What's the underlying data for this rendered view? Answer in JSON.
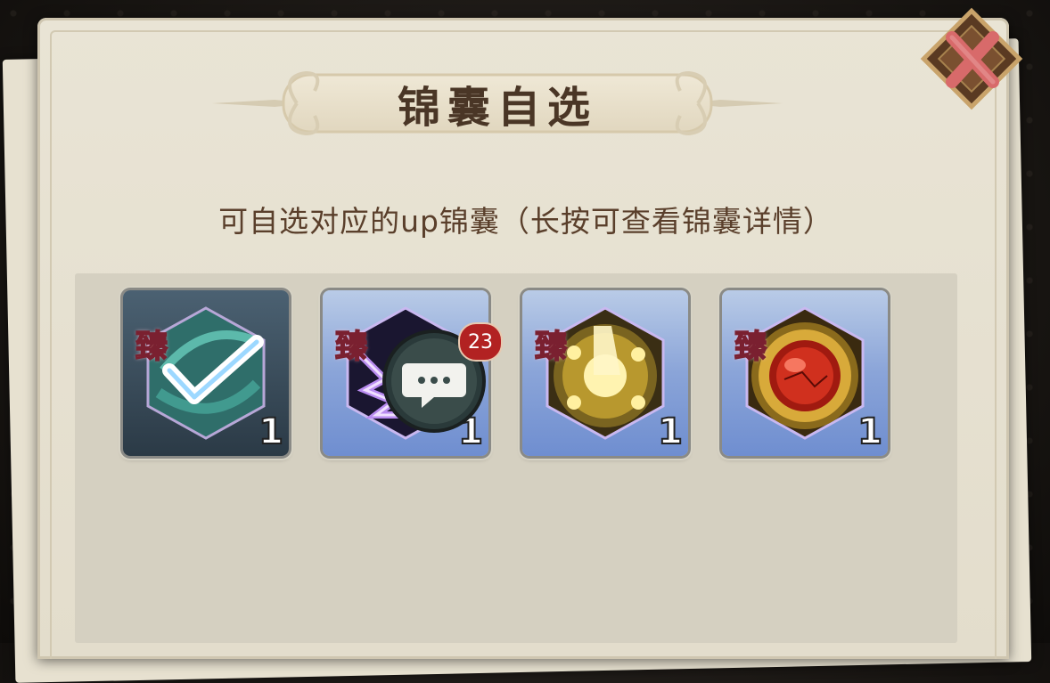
{
  "dialog": {
    "title": "锦囊自选",
    "subtitle": "可自选对应的up锦囊（长按可查看锦囊详情）"
  },
  "items": [
    {
      "tag": "臻",
      "count": "1",
      "icon": "check-swirl-icon",
      "selected": true
    },
    {
      "tag": "臻",
      "count": "1",
      "icon": "purple-claw-icon",
      "selected": false
    },
    {
      "tag": "臻",
      "count": "1",
      "icon": "golden-taiji-icon",
      "selected": false
    },
    {
      "tag": "臻",
      "count": "1",
      "icon": "red-orb-icon",
      "selected": false
    }
  ],
  "chat": {
    "badge_count": "23",
    "icon": "chat-bubble-icon"
  },
  "close": {
    "icon": "close-icon"
  },
  "colors": {
    "title_text": "#4a3626",
    "panel_bg": "#e7e1d0",
    "badge_red": "#b22222"
  }
}
